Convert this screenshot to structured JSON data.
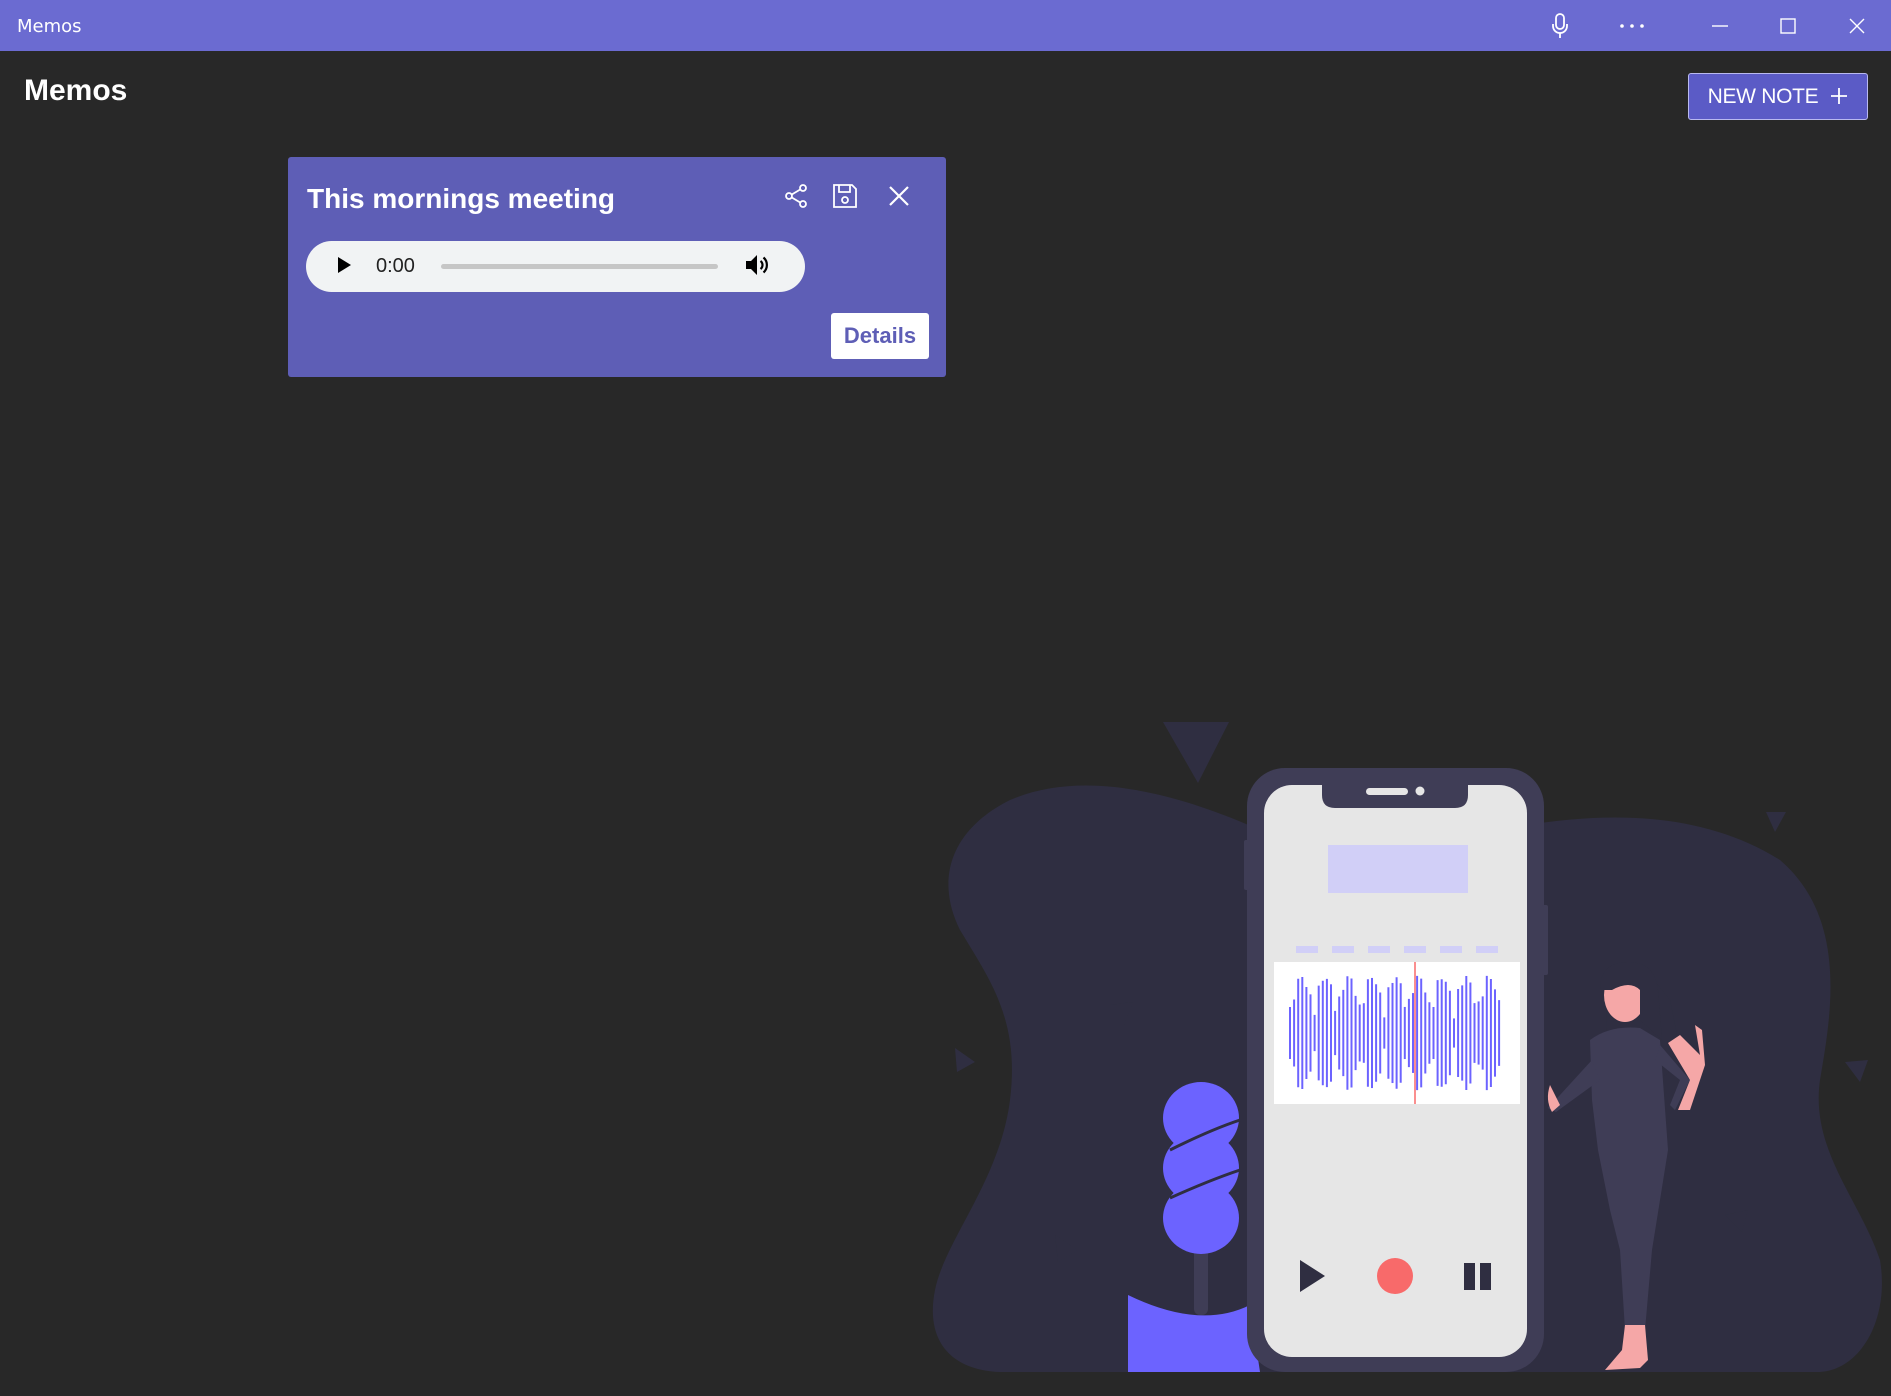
{
  "window": {
    "title": "Memos",
    "controls": [
      "microphone-icon",
      "more-icon",
      "minimize-icon",
      "maximize-icon",
      "close-icon"
    ]
  },
  "header": {
    "title": "Memos",
    "new_note_label": "NEW NOTE",
    "new_note_icon": "plus-icon"
  },
  "memo": {
    "title": "This mornings meeting",
    "actions": [
      "share-icon",
      "save-icon",
      "close-icon"
    ],
    "player": {
      "time": "0:00",
      "progress": 0
    },
    "details_label": "Details"
  },
  "colors": {
    "titlebar": "#6b6bd1",
    "background": "#282828",
    "card": "#5e5eb6",
    "accent": "#6c63ff",
    "record": "#f86a6a"
  }
}
